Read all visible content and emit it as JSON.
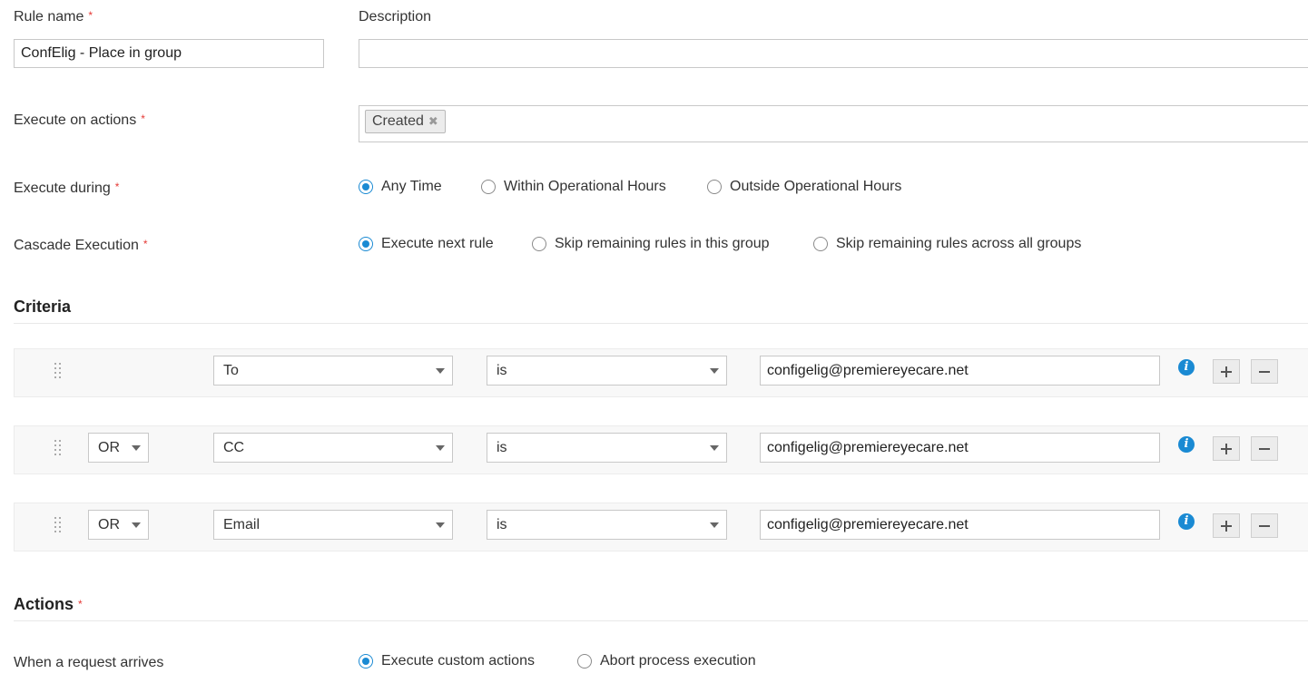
{
  "rule_name": {
    "label": "Rule name",
    "value": "ConfElig - Place in group"
  },
  "description": {
    "label": "Description",
    "value": ""
  },
  "execute_on_actions": {
    "label": "Execute on actions",
    "tags": [
      "Created"
    ]
  },
  "execute_during": {
    "label": "Execute during",
    "options": [
      "Any Time",
      "Within Operational Hours",
      "Outside Operational Hours"
    ],
    "selected": "Any Time"
  },
  "cascade_execution": {
    "label": "Cascade Execution",
    "options": [
      "Execute next rule",
      "Skip remaining rules in this group",
      "Skip remaining rules across all groups"
    ],
    "selected": "Execute next rule"
  },
  "criteria": {
    "title": "Criteria",
    "rows": [
      {
        "connector": "",
        "field": "To",
        "operator": "is",
        "value": "configelig@premiereyecare.net"
      },
      {
        "connector": "OR",
        "field": "CC",
        "operator": "is",
        "value": "configelig@premiereyecare.net"
      },
      {
        "connector": "OR",
        "field": "Email",
        "operator": "is",
        "value": "configelig@premiereyecare.net"
      }
    ]
  },
  "actions": {
    "title": "Actions",
    "when_label": "When a request arrives",
    "options": [
      "Execute custom actions",
      "Abort process execution"
    ],
    "selected": "Execute custom actions"
  },
  "required_marker": "*",
  "icons": {
    "remove_tag": "close-icon",
    "info": "info-icon",
    "drag": "drag-handle-icon",
    "add": "plus-icon",
    "remove": "minus-icon",
    "dropdown": "chevron-down-icon"
  },
  "colors": {
    "accent": "#1a8ad3",
    "required": "#e53935"
  }
}
